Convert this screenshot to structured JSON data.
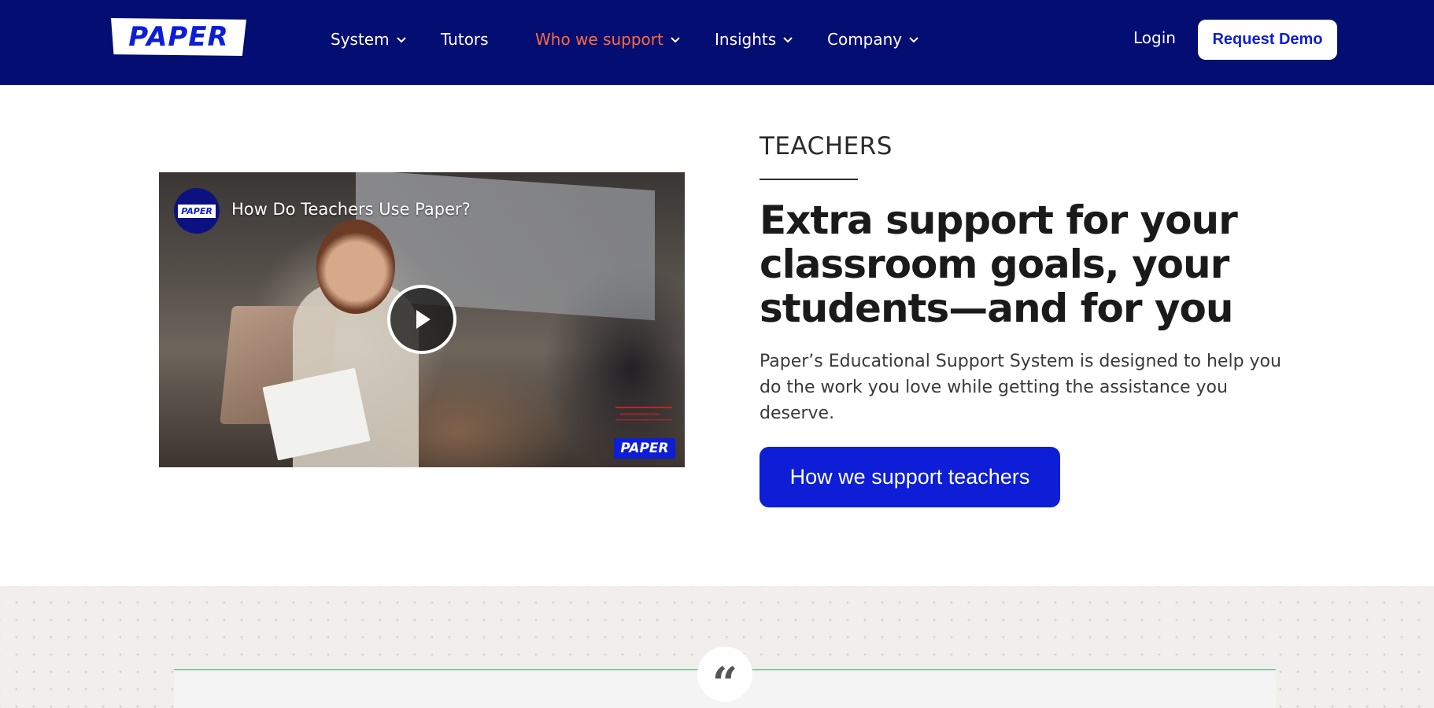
{
  "header": {
    "logo_text": "PAPER",
    "nav": [
      {
        "label": "System",
        "has_dropdown": true,
        "active": false
      },
      {
        "label": "Tutors",
        "has_dropdown": false,
        "active": false
      },
      {
        "label": "Who we support",
        "has_dropdown": true,
        "active": true
      },
      {
        "label": "Insights",
        "has_dropdown": true,
        "active": false
      },
      {
        "label": "Company",
        "has_dropdown": true,
        "active": false
      }
    ],
    "login_label": "Login",
    "demo_label": "Request Demo"
  },
  "video": {
    "title": "How Do Teachers Use Paper?",
    "channel_logo_text": "PAPER",
    "watermark_text": "PAPER",
    "play_icon": "play-icon"
  },
  "hero": {
    "eyebrow": "TEACHERS",
    "headline": "Extra support for your classroom goals, your students—and for you",
    "body": "Paper’s Educational Support System is designed to help you do the work you love while getting the assistance you deserve.",
    "cta_label": "How we support teachers"
  },
  "testimonial": {
    "quote_mark": "“"
  },
  "colors": {
    "nav_bg": "#040d72",
    "brand_blue": "#0d1ed6",
    "active_nav": "#ff6a3d",
    "band_line": "#37a35a"
  }
}
